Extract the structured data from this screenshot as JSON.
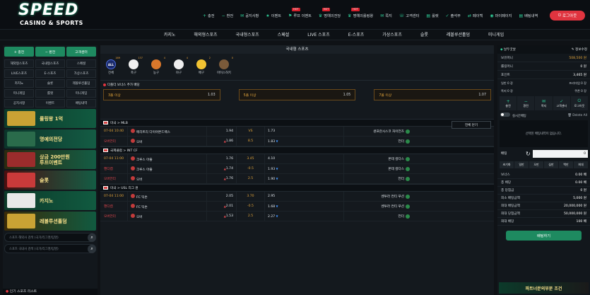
{
  "brand": {
    "title": "SPEED",
    "subtitle": "CASINO & SPORTS"
  },
  "topnav": [
    {
      "icon": "+",
      "label": "충전",
      "hot": ""
    },
    {
      "icon": "−",
      "label": "환전",
      "hot": ""
    },
    {
      "icon": "✉",
      "label": "공지사항",
      "hot": ""
    },
    {
      "icon": "★",
      "label": "이벤트",
      "hot": ""
    },
    {
      "icon": "⚑",
      "label": "루프 이벤트",
      "hot": "HOT"
    },
    {
      "icon": "♛",
      "label": "명예의전당",
      "hot": "HOT"
    },
    {
      "icon": "♛",
      "label": "명예의롤링왕",
      "hot": "HOT"
    },
    {
      "icon": "✉",
      "label": "쪽지",
      "hot": ""
    },
    {
      "icon": "☏",
      "label": "고객센터",
      "hot": ""
    },
    {
      "icon": "▤",
      "label": "룰렛",
      "hot": ""
    },
    {
      "icon": "✓",
      "label": "출석부",
      "hot": ""
    },
    {
      "icon": "⇄",
      "label": "페이백",
      "hot": ""
    },
    {
      "icon": "◉",
      "label": "마이페이지",
      "hot": ""
    },
    {
      "icon": "▤",
      "label": "배팅내역",
      "hot": ""
    }
  ],
  "logout_label": "로그아웃",
  "mainnav": [
    "카지노",
    "해외형스포츠",
    "국내형스포츠",
    "스페셜",
    "LIVE 스포츠",
    "E-스포츠",
    "가상스포츠",
    "슬롯",
    "레볼루션홀덤",
    "미니게임"
  ],
  "left": {
    "top_buttons": [
      "+ 충전",
      "− 환전",
      "고객센터"
    ],
    "grid": [
      "해외형스포츠",
      "국내형스포츠",
      "스페셜",
      "LIVE스포츠",
      "E-스포츠",
      "가상스포츠",
      "카지노",
      "슬롯",
      "레볼루션홀덤",
      "미니게임",
      "룰렛",
      "미니게임",
      "공지사항",
      "이벤트",
      "배팅내역"
    ],
    "banners": [
      {
        "t1": "롤링왕 1억",
        "t2": ""
      },
      {
        "t1": "명예의전당",
        "t2": ""
      },
      {
        "t1": "상금 200만원",
        "t2": "루프이벤트"
      },
      {
        "t1": "슬롯",
        "t2": ""
      },
      {
        "t1": "카지노",
        "t2": ""
      },
      {
        "t1": "레볼루션홀덤",
        "t2": ""
      }
    ],
    "search1": "스포츠 해외사 검색 (국가/리그명/팀명)",
    "search2": "스포츠 국내사 검색 (국가/리그명/팀명)",
    "footer": "인기 스포츠 리스트"
  },
  "center": {
    "title": "국내형 스포츠",
    "categories": [
      {
        "label": "전체",
        "count": "169",
        "ball": "ALL"
      },
      {
        "label": "축구",
        "count": "137",
        "ball": ""
      },
      {
        "label": "농구",
        "count": "4",
        "ball": ""
      },
      {
        "label": "야구",
        "count": "4",
        "ball": ""
      },
      {
        "label": "배구",
        "count": "2",
        "ball": ""
      },
      {
        "label": "아이스하키",
        "count": "0",
        "ball": ""
      }
    ],
    "bonus_title": "다폴더 보너스 추가 배당",
    "bonus": [
      {
        "label": "3폴 이상",
        "value": "1.03"
      },
      {
        "label": "5폴 이상",
        "value": "1.05"
      },
      {
        "label": "7폴 이상",
        "value": "1.07"
      }
    ],
    "detail_label": "전체 닫기",
    "leagues": [
      {
        "name": "미국 > MLB",
        "rows": [
          {
            "time": "07-04 10:40",
            "live": false,
            "home": "메리트리 다이아몬드백스",
            "hodd": "1.94",
            "harrow": "",
            "mid": "VS",
            "away": "샌프란시스코 자이언츠",
            "aodd": "1.73",
            "aarrow": ""
          },
          {
            "time": "오버언더",
            "live": true,
            "home": "오버",
            "hodd": "1.86",
            "harrow": "up",
            "mid": "8.5",
            "away": "언더",
            "aodd": "1.83",
            "aarrow": "dn"
          }
        ]
      },
      {
        "name": "국제클럽 > INT CF",
        "rows": [
          {
            "time": "07-04 11:00",
            "live": false,
            "home": "크루스 아줄",
            "hodd": "1.76",
            "harrow": "",
            "mid": "3.45",
            "away": "몬테 칼다스",
            "aodd": "4.10",
            "aarrow": ""
          },
          {
            "time": "핸디캡",
            "live": true,
            "home": "크루스 아줄",
            "hodd": "1.74",
            "harrow": "up",
            "mid": "-0.5",
            "away": "몬테 칼다스",
            "aodd": "1.93",
            "aarrow": "dn"
          },
          {
            "time": "오버언더",
            "live": true,
            "home": "오버",
            "hodd": "1.76",
            "harrow": "up",
            "mid": "2.5",
            "away": "언더",
            "aodd": "1.90",
            "aarrow": "dn"
          }
        ]
      },
      {
        "name": "미국 > USL 리그 원",
        "rows": [
          {
            "time": "07-04 11:00",
            "live": false,
            "home": "FC 턱손",
            "hodd": "2.05",
            "harrow": "",
            "mid": "3.70",
            "away": "벤투라 컨티 푸션",
            "aodd": "2.95",
            "aarrow": ""
          },
          {
            "time": "핸디캡",
            "live": true,
            "home": "FC 턱손",
            "hodd": "2.01",
            "harrow": "up",
            "mid": "-0.5",
            "away": "벤투라 컨티 푸션",
            "aodd": "1.68",
            "aarrow": "dn"
          },
          {
            "time": "오버언더",
            "live": true,
            "home": "오버",
            "hodd": "1.53",
            "harrow": "up",
            "mid": "2.5",
            "away": "언더",
            "aodd": "2.27",
            "aarrow": "dn"
          }
        ]
      }
    ]
  },
  "right": {
    "user": "날두굿날",
    "myinfo": "정보수정",
    "rows": [
      {
        "label": "보유머니",
        "value": "508,500 원"
      },
      {
        "label": "롤링머니",
        "value": "0 원"
      },
      {
        "label": "포인트",
        "value": "3,465 원"
      }
    ],
    "small": [
      {
        "label": "일반 0 장",
        "value": "프리미엄 0 장"
      },
      {
        "label": "쪽지 0 장",
        "value": "쿠폰 0 장"
      }
    ],
    "icons": [
      "충전",
      "환전",
      "쪽지",
      "고객센터",
      "로그아웃"
    ],
    "slip_label": "실시간배팅",
    "delete_label": "Delete All",
    "slip_empty": "선택된 배팅내역이 없습니다.",
    "bet_label": "배팅",
    "bet_value": "0",
    "chips": [
      "초기화",
      "일만",
      "오만",
      "십만",
      "백만",
      "최대"
    ],
    "info": [
      {
        "label": "보너스",
        "value": "0.00 배"
      },
      {
        "label": "총 배당",
        "value": "0.00 배"
      },
      {
        "label": "총 당첨금",
        "value": "0 원"
      },
      {
        "label": "최소 배팅금액",
        "value": "5,000 원"
      },
      {
        "label": "최대 배팅금액",
        "value": "20,000,000 원"
      },
      {
        "label": "최대 당첨금액",
        "value": "50,000,000 원"
      },
      {
        "label": "최대 배당",
        "value": "100 배"
      }
    ],
    "bet_button": "배팅하기",
    "banner": "파트너문의부분 조건"
  }
}
